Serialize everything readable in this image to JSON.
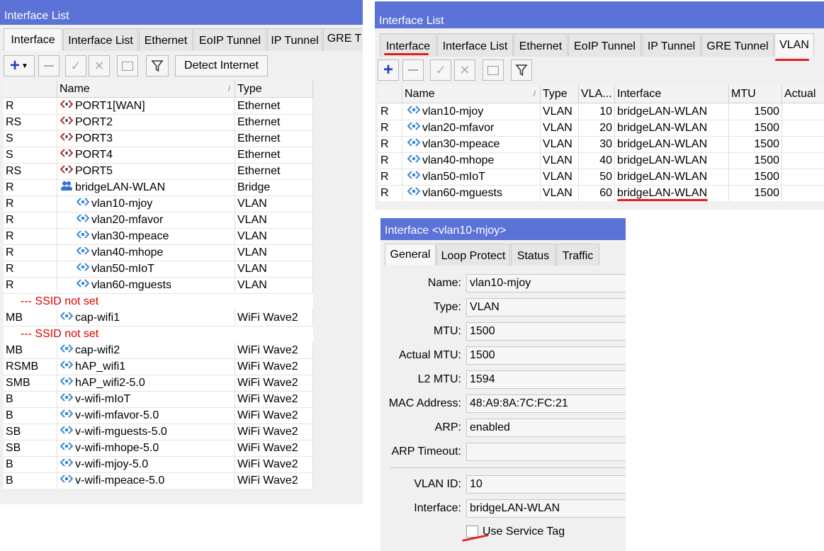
{
  "left": {
    "title": "Interface List",
    "tabs": [
      "Interface",
      "Interface List",
      "Ethernet",
      "EoIP Tunnel",
      "IP Tunnel",
      "GRE T"
    ],
    "toolbar": {
      "detect_label": "Detect Internet"
    },
    "columns": [
      "",
      "Name",
      "Type"
    ],
    "rows": [
      {
        "flags": "R",
        "name": "PORT1[WAN]",
        "type": "Ethernet",
        "icon": "ethernet"
      },
      {
        "flags": "RS",
        "name": "PORT2",
        "type": "Ethernet",
        "icon": "ethernet"
      },
      {
        "flags": "S",
        "name": "PORT3",
        "type": "Ethernet",
        "icon": "ethernet"
      },
      {
        "flags": "S",
        "name": "PORT4",
        "type": "Ethernet",
        "icon": "ethernet"
      },
      {
        "flags": "RS",
        "name": "PORT5",
        "type": "Ethernet",
        "icon": "ethernet"
      },
      {
        "flags": "R",
        "name": "bridgeLAN-WLAN",
        "type": "Bridge",
        "icon": "bridge"
      },
      {
        "flags": "R",
        "name": "vlan10-mjoy",
        "type": "VLAN",
        "icon": "vlan"
      },
      {
        "flags": "R",
        "name": "vlan20-mfavor",
        "type": "VLAN",
        "icon": "vlan"
      },
      {
        "flags": "R",
        "name": "vlan30-mpeace",
        "type": "VLAN",
        "icon": "vlan"
      },
      {
        "flags": "R",
        "name": "vlan40-mhope",
        "type": "VLAN",
        "icon": "vlan"
      },
      {
        "flags": "R",
        "name": "vlan50-mIoT",
        "type": "VLAN",
        "icon": "vlan"
      },
      {
        "flags": "R",
        "name": "vlan60-mguests",
        "type": "VLAN",
        "icon": "vlan"
      },
      {
        "separator": "--- SSID not set"
      },
      {
        "flags": "MB",
        "name": "cap-wifi1",
        "type": "WiFi Wave2",
        "icon": "wifi"
      },
      {
        "separator": "--- SSID not set"
      },
      {
        "flags": "MB",
        "name": "cap-wifi2",
        "type": "WiFi Wave2",
        "icon": "wifi"
      },
      {
        "flags": "RSMB",
        "name": "hAP_wifi1",
        "type": "WiFi Wave2",
        "icon": "wifi"
      },
      {
        "flags": "SMB",
        "name": "hAP_wifi2-5.0",
        "type": "WiFi Wave2",
        "icon": "wifi"
      },
      {
        "flags": "B",
        "name": "v-wifi-mIoT",
        "type": "WiFi Wave2",
        "icon": "wifi"
      },
      {
        "flags": "B",
        "name": "v-wifi-mfavor-5.0",
        "type": "WiFi Wave2",
        "icon": "wifi"
      },
      {
        "flags": "SB",
        "name": "v-wifi-mguests-5.0",
        "type": "WiFi Wave2",
        "icon": "wifi"
      },
      {
        "flags": "SB",
        "name": "v-wifi-mhope-5.0",
        "type": "WiFi Wave2",
        "icon": "wifi"
      },
      {
        "flags": "B",
        "name": "v-wifi-mjoy-5.0",
        "type": "WiFi Wave2",
        "icon": "wifi"
      },
      {
        "flags": "B",
        "name": "v-wifi-mpeace-5.0",
        "type": "WiFi Wave2",
        "icon": "wifi"
      }
    ]
  },
  "right": {
    "title": "Interface List",
    "tabs": [
      "Interface",
      "Interface List",
      "Ethernet",
      "EoIP Tunnel",
      "IP Tunnel",
      "GRE Tunnel",
      "VLAN"
    ],
    "columns": [
      "",
      "Name",
      "Type",
      "VLA...",
      "Interface",
      "MTU",
      "Actual"
    ],
    "rows": [
      {
        "flags": "R",
        "name": "vlan10-mjoy",
        "type": "VLAN",
        "vlan": "10",
        "iface": "bridgeLAN-WLAN",
        "mtu": "1500"
      },
      {
        "flags": "R",
        "name": "vlan20-mfavor",
        "type": "VLAN",
        "vlan": "20",
        "iface": "bridgeLAN-WLAN",
        "mtu": "1500"
      },
      {
        "flags": "R",
        "name": "vlan30-mpeace",
        "type": "VLAN",
        "vlan": "30",
        "iface": "bridgeLAN-WLAN",
        "mtu": "1500"
      },
      {
        "flags": "R",
        "name": "vlan40-mhope",
        "type": "VLAN",
        "vlan": "40",
        "iface": "bridgeLAN-WLAN",
        "mtu": "1500"
      },
      {
        "flags": "R",
        "name": "vlan50-mIoT",
        "type": "VLAN",
        "vlan": "50",
        "iface": "bridgeLAN-WLAN",
        "mtu": "1500"
      },
      {
        "flags": "R",
        "name": "vlan60-mguests",
        "type": "VLAN",
        "vlan": "60",
        "iface": "bridgeLAN-WLAN",
        "mtu": "1500"
      }
    ]
  },
  "detail": {
    "title": "Interface <vlan10-mjoy>",
    "tabs": [
      "General",
      "Loop Protect",
      "Status",
      "Traffic"
    ],
    "fields": [
      {
        "label": "Name:",
        "value": "vlan10-mjoy"
      },
      {
        "label": "Type:",
        "value": "VLAN"
      },
      {
        "label": "MTU:",
        "value": "1500"
      },
      {
        "label": "Actual MTU:",
        "value": "1500"
      },
      {
        "label": "L2 MTU:",
        "value": "1594"
      },
      {
        "label": "MAC Address:",
        "value": "48:A9:8A:7C:FC:21"
      },
      {
        "label": "ARP:",
        "value": "enabled"
      },
      {
        "label": "ARP Timeout:",
        "value": ""
      }
    ],
    "fields2": [
      {
        "label": "VLAN ID:",
        "value": "10"
      },
      {
        "label": "Interface:",
        "value": "bridgeLAN-WLAN"
      }
    ],
    "checkbox_label": "Use Service Tag"
  },
  "colors": {
    "title_bar": "#5b72d6",
    "separator_text": "#e00000",
    "annotation": "#e41e1e",
    "add_icon": "#1f3fbf"
  }
}
